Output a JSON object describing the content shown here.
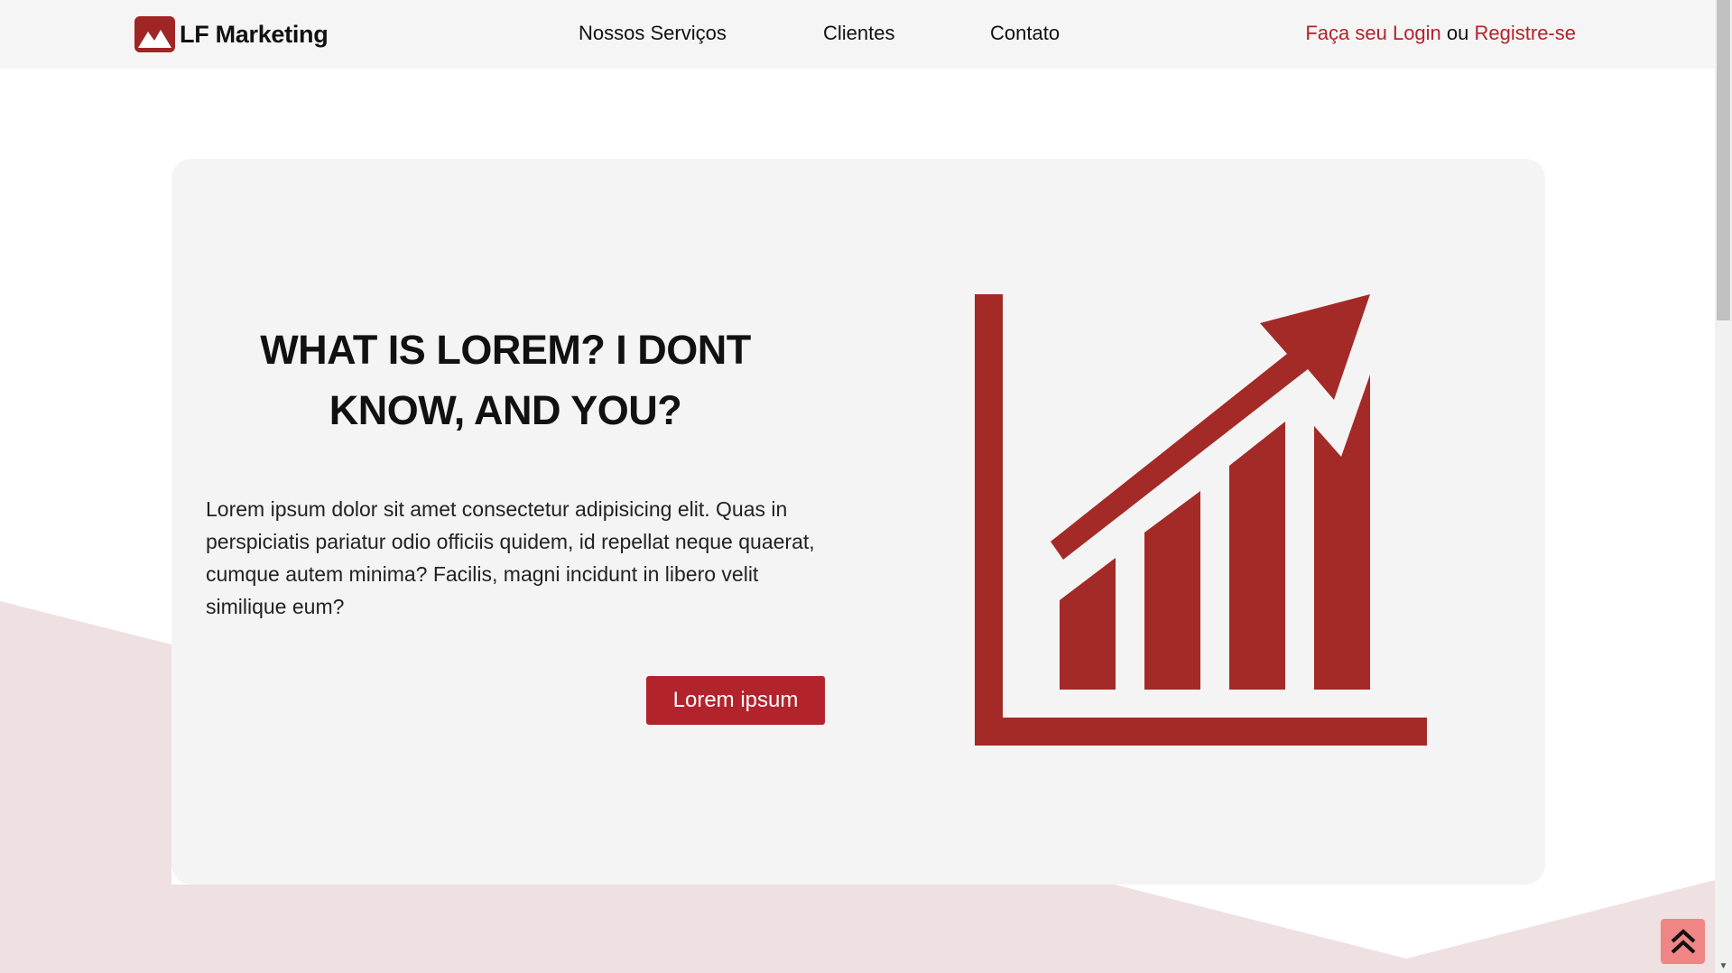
{
  "header": {
    "brand": "LF Marketing",
    "nav": [
      "Nossos Serviços",
      "Clientes",
      "Contato"
    ],
    "auth": {
      "login": "Faça seu Login",
      "separator": "ou",
      "register": "Registre-se"
    }
  },
  "hero": {
    "title": "WHAT IS LOREM? I DONT KNOW, AND YOU?",
    "body": "Lorem ipsum dolor sit amet consectetur adipisicing elit. Quas in perspiciatis pariatur odio officiis quidem, id repellat neque quaerat, cumque autem minima? Facilis, magni incidunt in libero velit similique eum?",
    "cta": "Lorem ipsum",
    "illustration": "growth-chart-icon"
  },
  "colors": {
    "accent": "#b3232b",
    "illustration": "#a32a27",
    "background_shape": "#efe0e1",
    "card": "#f4f4f4",
    "header": "#f5f5f5",
    "back_to_top": "#f08585"
  },
  "icons": {
    "back_to_top": "double-chevron-up-icon",
    "logo": "mountain-logo-icon"
  }
}
